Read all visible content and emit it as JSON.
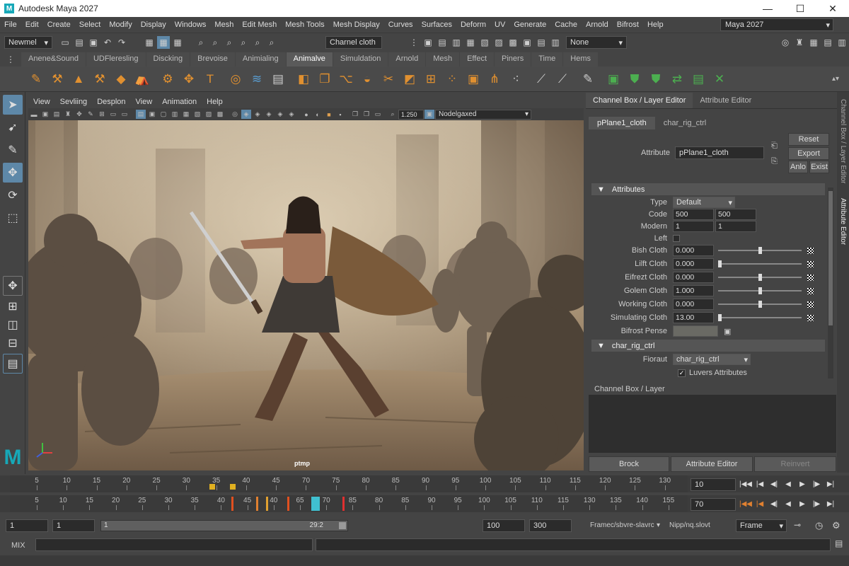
{
  "window": {
    "title": "Autodesk Maya 2027",
    "min": "—",
    "max": "☐",
    "close": "✕"
  },
  "menu": [
    "File",
    "Edit",
    "Create",
    "Select",
    "Modify",
    "Display",
    "Windows",
    "Mesh",
    "Edit Mesh",
    "Mesh Tools",
    "Mesh Display",
    "Curves",
    "Surfaces",
    "Deform",
    "UV",
    "Generate",
    "Cache",
    "Arnold",
    "Bifrost",
    "Help"
  ],
  "workspace": "Maya 2027",
  "statusline": {
    "menuset": "Newmel",
    "object": "Charnel cloth",
    "live": "None"
  },
  "shelf_tabs": [
    "Anene&Sound",
    "UDFleresling",
    "Discking",
    "Brevoise",
    "Animialing",
    "Animalve",
    "Simuldation",
    "Arnold",
    "Mesh",
    "Effect",
    "Piners",
    "Time",
    "Hems"
  ],
  "shelf_active": "Animalve",
  "viewport": {
    "menu": [
      "View",
      "Sevliing",
      "Desplon",
      "View",
      "Animation",
      "Help"
    ],
    "value": "1.250",
    "camera": "Nodelgaxed",
    "label": "ptmp"
  },
  "panel": {
    "tabs": [
      "Channel Box / Layer Editor",
      "Attribute Editor"
    ],
    "node_tabs": [
      "pPlane1_cloth",
      "char_rig_ctrl"
    ],
    "attribute_label": "Attribute",
    "attribute_value": "pPlane1_cloth",
    "buttons": {
      "reset": "Reset",
      "export": "Export",
      "anlo": "Anlo",
      "exist": "Exist"
    },
    "section1": "Attributes",
    "type_label": "Type",
    "type_value": "Default",
    "code_label": "Code",
    "code_a": "500",
    "code_b": "500",
    "modern_label": "Modern",
    "modern_a": "1",
    "modern_b": "1",
    "left_label": "Left",
    "sliders": [
      {
        "label": "Bish Cloth",
        "value": "0.000",
        "pos": 0.5
      },
      {
        "label": "Lilft Cloth",
        "value": "0.000",
        "pos": 0.0
      },
      {
        "label": "Eifrezt Cloth",
        "value": "0.000",
        "pos": 0.5
      },
      {
        "label": "Golem Cloth",
        "value": "1.000",
        "pos": 0.5
      },
      {
        "label": "Working Cloth",
        "value": "0.000",
        "pos": 0.5
      },
      {
        "label": "Simulating Cloth",
        "value": "13.00",
        "pos": 0.0
      }
    ],
    "bifrost_label": "Bifrost Pense",
    "section2": "char_rig_ctrl",
    "fioraut_label": "Fioraut",
    "fioraut_value": "char_rig_ctrl",
    "luvers": "Luvers Attributes",
    "channel_box": "Channel Box / Layer",
    "bottom": {
      "brock": "Brock",
      "attr": "Attribute Editor",
      "reinvert": "Reinvert"
    },
    "side_tabs": [
      "Channel Box / Layer Editor",
      "Attribute Editor"
    ]
  },
  "timeline": {
    "ticks1": [
      "5",
      "10",
      "15",
      "20",
      "25",
      "30",
      "35",
      "40",
      "45",
      "70",
      "75",
      "80",
      "85",
      "90",
      "95",
      "100",
      "105",
      "110",
      "115",
      "120",
      "125",
      "130"
    ],
    "ticks2": [
      "5",
      "10",
      "15",
      "20",
      "25",
      "30",
      "35",
      "40",
      "45",
      "40",
      "65",
      "70",
      "85",
      "80",
      "85",
      "90",
      "95",
      "100",
      "105",
      "110",
      "115",
      "130",
      "135",
      "140",
      "155"
    ],
    "frame1": "10",
    "frame2": "70"
  },
  "range": {
    "start": "1",
    "start2": "1",
    "inner_start": "1",
    "inner_end": "29:2",
    "end": "100",
    "end2": "300",
    "fps": "Framec/sbvre-slavrc",
    "keys": "Nipp/nq.slovt",
    "mode": "Frame"
  },
  "cmd": {
    "label": "MIX"
  },
  "colors": {
    "accent": "#5e88a8",
    "shelf_icon": "#e09030",
    "green_icon": "#4caf50"
  }
}
